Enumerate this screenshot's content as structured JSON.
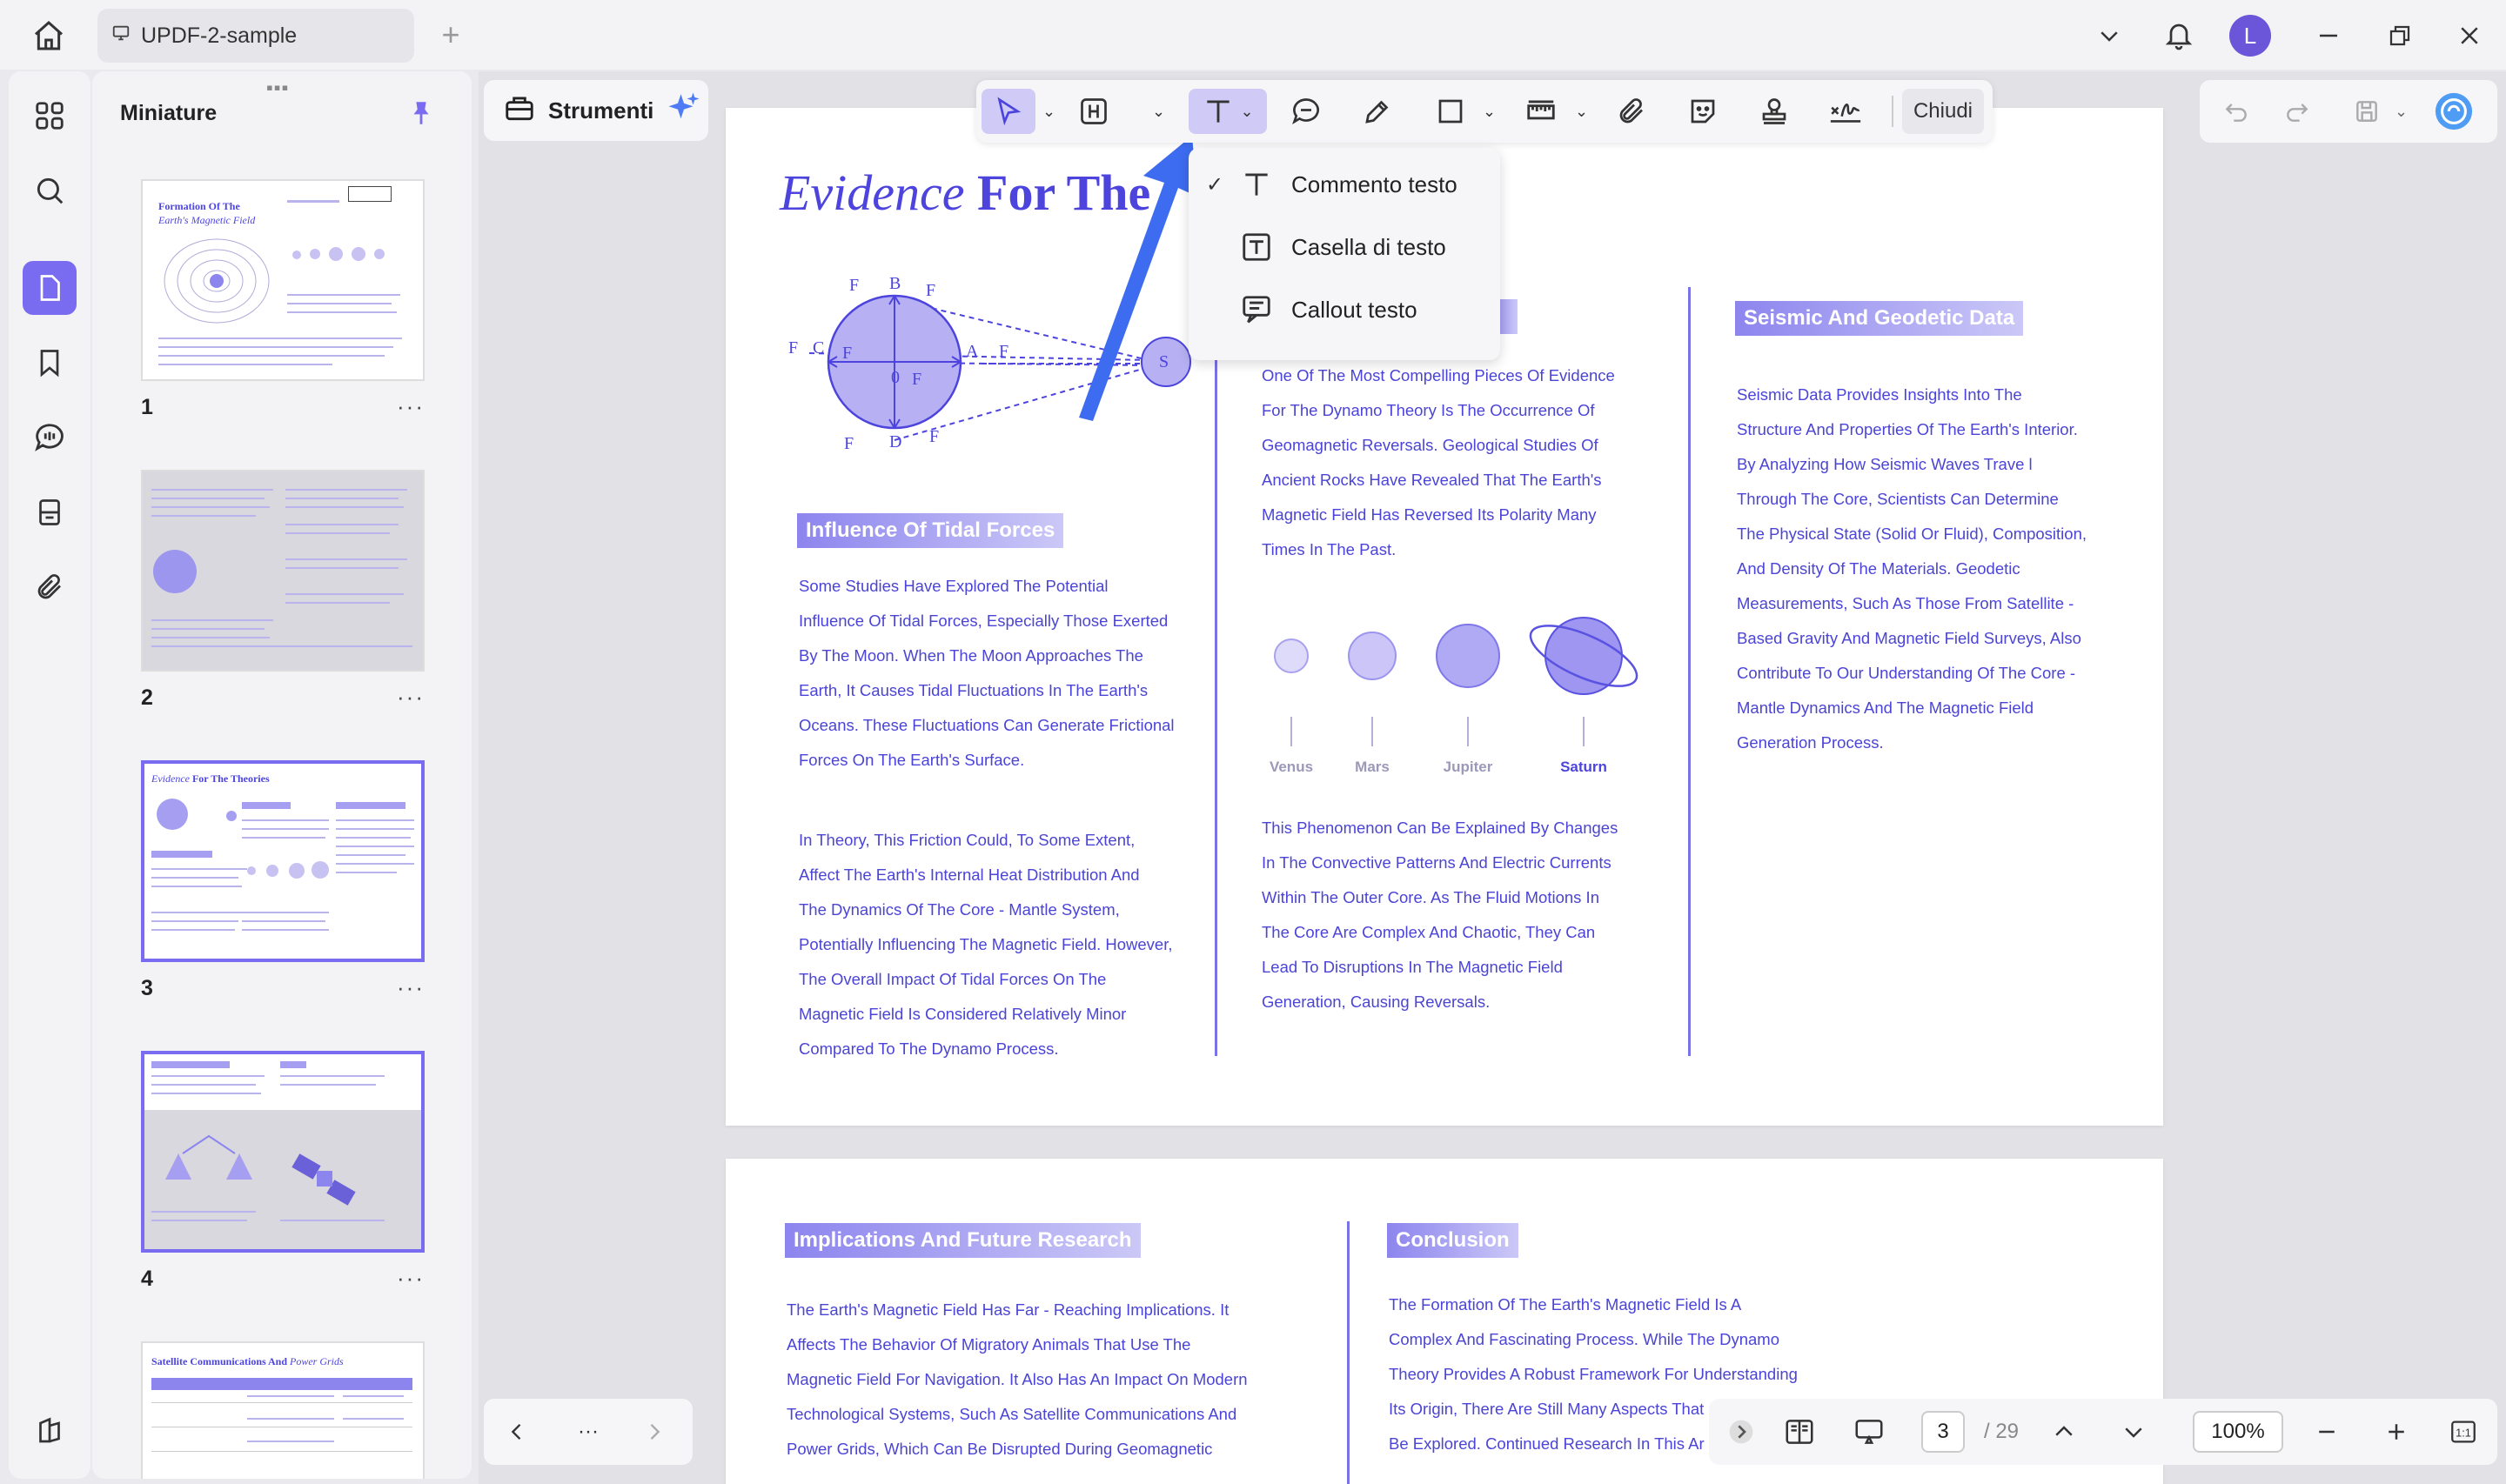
{
  "window": {
    "tab_title": "UPDF-2-sample",
    "avatar_letter": "L"
  },
  "thumbnails": {
    "title": "Miniature",
    "pages": [
      {
        "number": "1",
        "heading": "Formation Of The",
        "heading2": "Earth's Magnetic Field"
      },
      {
        "number": "2"
      },
      {
        "number": "3",
        "heading": "Evidence",
        "heading2": "For The Theories"
      },
      {
        "number": "4"
      },
      {
        "number": "",
        "heading": "Satellite Communications And",
        "heading2": "Power Grids"
      }
    ],
    "more": "···"
  },
  "tools_panel": {
    "label": "Strumenti"
  },
  "toolbar": {
    "close_label": "Chiudi"
  },
  "text_menu": {
    "items": [
      {
        "label": "Commento testo",
        "checked": true
      },
      {
        "label": "Casella di testo",
        "checked": false
      },
      {
        "label": "Callout testo",
        "checked": false
      }
    ],
    "check": "✓"
  },
  "document": {
    "page3": {
      "title_italic": "Evidence",
      "title_bold": "For The",
      "influence_heading": "Influence Of Tidal Forces",
      "influence_para1": [
        "Some Studies Have Explored The Potential",
        "Influence Of Tidal Forces, Especially Those Exerted",
        "By The Moon. When The Moon Approaches The",
        "Earth, It Causes Tidal Fluctuations In The Earth's",
        "Oceans. These Fluctuations Can Generate Frictional",
        "Forces On The Earth's Surface."
      ],
      "influence_para2": [
        " In Theory, This Friction Could, To Some Extent,",
        "Affect The Earth's Internal Heat Distribution And",
        "The Dynamics Of The Core - Mantle System,",
        "Potentially Influencing The Magnetic Field. However,",
        "The Overall Impact Of Tidal Forces On The",
        "Magnetic Field Is Considered Relatively Minor",
        "Compared To The Dynamo Process."
      ],
      "middle_para1": [
        "One Of The Most Compelling Pieces Of Evidence",
        "For The Dynamo Theory Is The Occurrence Of",
        "Geomagnetic Reversals. Geological Studies Of",
        "Ancient Rocks Have Revealed That The Earth's",
        "Magnetic Field Has Reversed Its Polarity Many",
        "Times In The Past."
      ],
      "planets": [
        "Venus",
        "Mars",
        "Jupiter",
        "Saturn"
      ],
      "middle_para2": [
        "This Phenomenon Can Be Explained By Changes",
        "In The Convective Patterns And Electric Currents",
        "Within The Outer Core. As The Fluid Motions In",
        "The Core Are Complex And Chaotic, They Can",
        "Lead To Disruptions In The Magnetic Field",
        "Generation, Causing Reversals."
      ],
      "seismic_heading": "Seismic And Geodetic Data",
      "seismic_para": [
        "Seismic Data Provides Insights Into The",
        "Structure And Properties Of The Earth's Interior.",
        "By Analyzing How Seismic Waves Trave l",
        "Through The Core, Scientists Can Determine",
        "The Physical State (Solid Or Fluid), Composition,",
        "And Density Of The Materials. Geodetic",
        "Measurements, Such As Those From Satellite -",
        "Based Gravity And Magnetic Field Surveys, Also",
        "Contribute To Our Understanding Of The Core -",
        "Mantle Dynamics And The Magnetic Field",
        "Generation Process."
      ],
      "diagram_labels": {
        "B": "B",
        "C": "C",
        "D": "D",
        "A": "A",
        "S": "S",
        "zero": "0",
        "Fe": "F",
        "Fg": "F",
        "Fr": "F"
      }
    },
    "page4": {
      "implications_heading": "Implications And Future Research",
      "implications_para": [
        "The Earth's Magnetic Field Has Far - Reaching Implications. It",
        "Affects The Behavior Of Migratory Animals That Use The",
        "Magnetic Field For Navigation. It Also Has An Impact On Modern",
        "Technological Systems, Such As Satellite Communications And",
        "Power Grids, Which Can Be Disrupted During Geomagnetic"
      ],
      "conclusion_heading": "Conclusion",
      "conclusion_para": [
        "The Formation Of The Earth's Magnetic Field Is A",
        "Complex And Fascinating Process. While The Dynamo",
        "Theory Provides A Robust Framework For Understanding",
        "Its Origin, There Are Still Many Aspects That",
        "Be Explored. Continued Research In This Ar"
      ]
    }
  },
  "status": {
    "current_page": "3",
    "total_pages": "/ 29",
    "zoom": "100%",
    "nav_more": "···"
  },
  "colors": {
    "accent": "#7a6cf0",
    "document_text": "#4b44d6",
    "arrow": "#3d6cf0"
  }
}
